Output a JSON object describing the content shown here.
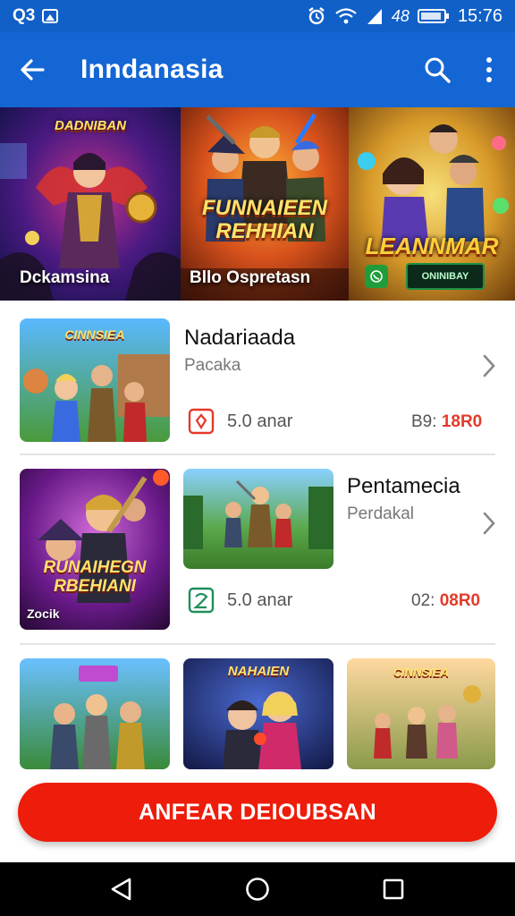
{
  "status_bar": {
    "left_text": "Q3",
    "time": "15:76",
    "indicator_text": "48",
    "icons": [
      "image-icon",
      "alarm-icon",
      "wifi-icon",
      "signal-icon",
      "battery-icon"
    ]
  },
  "app_bar": {
    "title": "Inndanasia",
    "icons": [
      "back-arrow-icon",
      "search-icon",
      "more-vert-icon"
    ]
  },
  "banner": {
    "panels": [
      {
        "label": "Dckamsina",
        "logo": "DADNIBAN"
      },
      {
        "label": "Bllo Ospretasn",
        "logo_line1": "FUNNAIEEN",
        "logo_line2": "REHHIAN"
      },
      {
        "logo": "LEANNMAR",
        "tag": "ONINIBAY"
      }
    ]
  },
  "items": [
    {
      "title": "Nadariaada",
      "subtitle": "Pacaka",
      "meta": "5.0 anar",
      "price_prefix": "B9:",
      "price_value": "18R0",
      "thumb_logo": "CINNSIEA"
    },
    {
      "title": "Pentamecia",
      "subtitle": "Perdakal",
      "meta": "5.0 anar",
      "price_prefix": "02:",
      "price_value": "08R0",
      "thumb_label": "Zocik",
      "thumb_logo_line1": "RUNAIHEGN",
      "thumb_logo_line2": "RBEHIANI"
    },
    {
      "thumb_logo_a": "NAHAIEN",
      "thumb_logo_b": "CINNSIEA"
    }
  ],
  "cta": {
    "label": "ANFEAR DEIOUBSAN"
  },
  "nav": {
    "icons": [
      "back-triangle-icon",
      "home-circle-icon",
      "recents-square-icon"
    ]
  },
  "colors": {
    "primary": "#1466d4",
    "accent": "#ee1c0a",
    "price": "#e53a2a"
  }
}
